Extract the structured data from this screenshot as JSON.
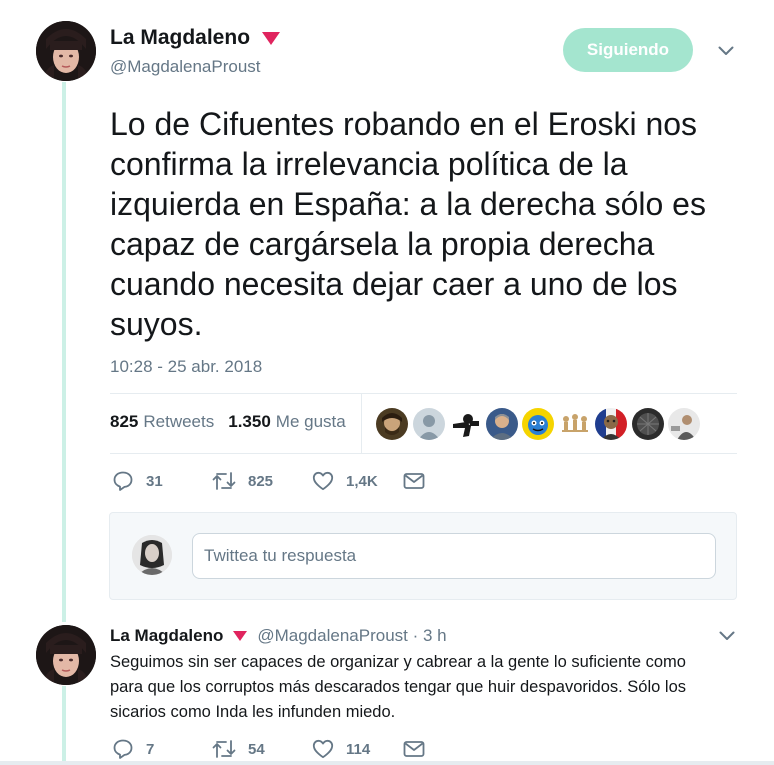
{
  "tweet": {
    "author_name": "La Magdaleno",
    "author_handle": "@MagdalenaProust",
    "follow_label": "Siguiendo",
    "text": "Lo de Cifuentes robando en el Eroski nos confirma la irrelevancia política de la izquierda en España: a la derecha sólo es capaz de cargársela la propia derecha cuando necesita dejar caer a uno de los suyos.",
    "timestamp": "10:28 - 25 abr. 2018",
    "stats": {
      "retweets_count": "825",
      "retweets_label": "Retweets",
      "likes_count": "1.350",
      "likes_label": "Me gusta"
    },
    "liker_faces": [
      "face-1",
      "face-2",
      "face-3",
      "face-4",
      "face-5",
      "face-6",
      "face-7",
      "face-8",
      "face-9"
    ],
    "actions": {
      "replies": "31",
      "retweets": "825",
      "likes": "1,4K"
    }
  },
  "reply_composer": {
    "placeholder": "Twittea tu respuesta"
  },
  "reply": {
    "author_name": "La Magdaleno",
    "meta": "@MagdalenaProust · 3 h",
    "text": "Seguimos sin ser capaces de organizar y cabrear a la gente lo suficiente como para que los corruptos más descarados tengar que huir despavoridos. Sólo los sicarios como Inda les infunden miedo.",
    "actions": {
      "replies": "7",
      "retweets": "54",
      "likes": "114"
    }
  },
  "icons": {
    "verified": "triangle-badge-icon",
    "chevron": "chevron-down-icon",
    "reply": "reply-bubble-icon",
    "retweet": "retweet-icon",
    "like": "heart-icon",
    "message": "envelope-icon"
  },
  "colors": {
    "follow_button": "#a4e5cf",
    "thread_line": "#ccf0e6",
    "badge": "#e0245e",
    "secondary_text": "#657786"
  }
}
